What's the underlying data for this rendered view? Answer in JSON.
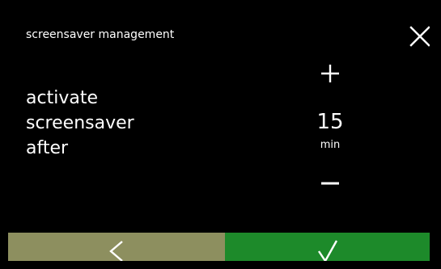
{
  "header": {
    "title": "screensaver management"
  },
  "icons": {
    "close": "close-icon",
    "plus": "plus-icon",
    "minus": "minus-icon",
    "back": "chevron-left-icon",
    "confirm": "checkmark-icon"
  },
  "setting": {
    "label_lines": [
      "activate",
      "screensaver",
      "after"
    ],
    "value": "15",
    "unit": "min"
  },
  "colors": {
    "background": "#000000",
    "text": "#ffffff",
    "back_button": "#8d8f5f",
    "confirm_button": "#1d8a2a"
  }
}
